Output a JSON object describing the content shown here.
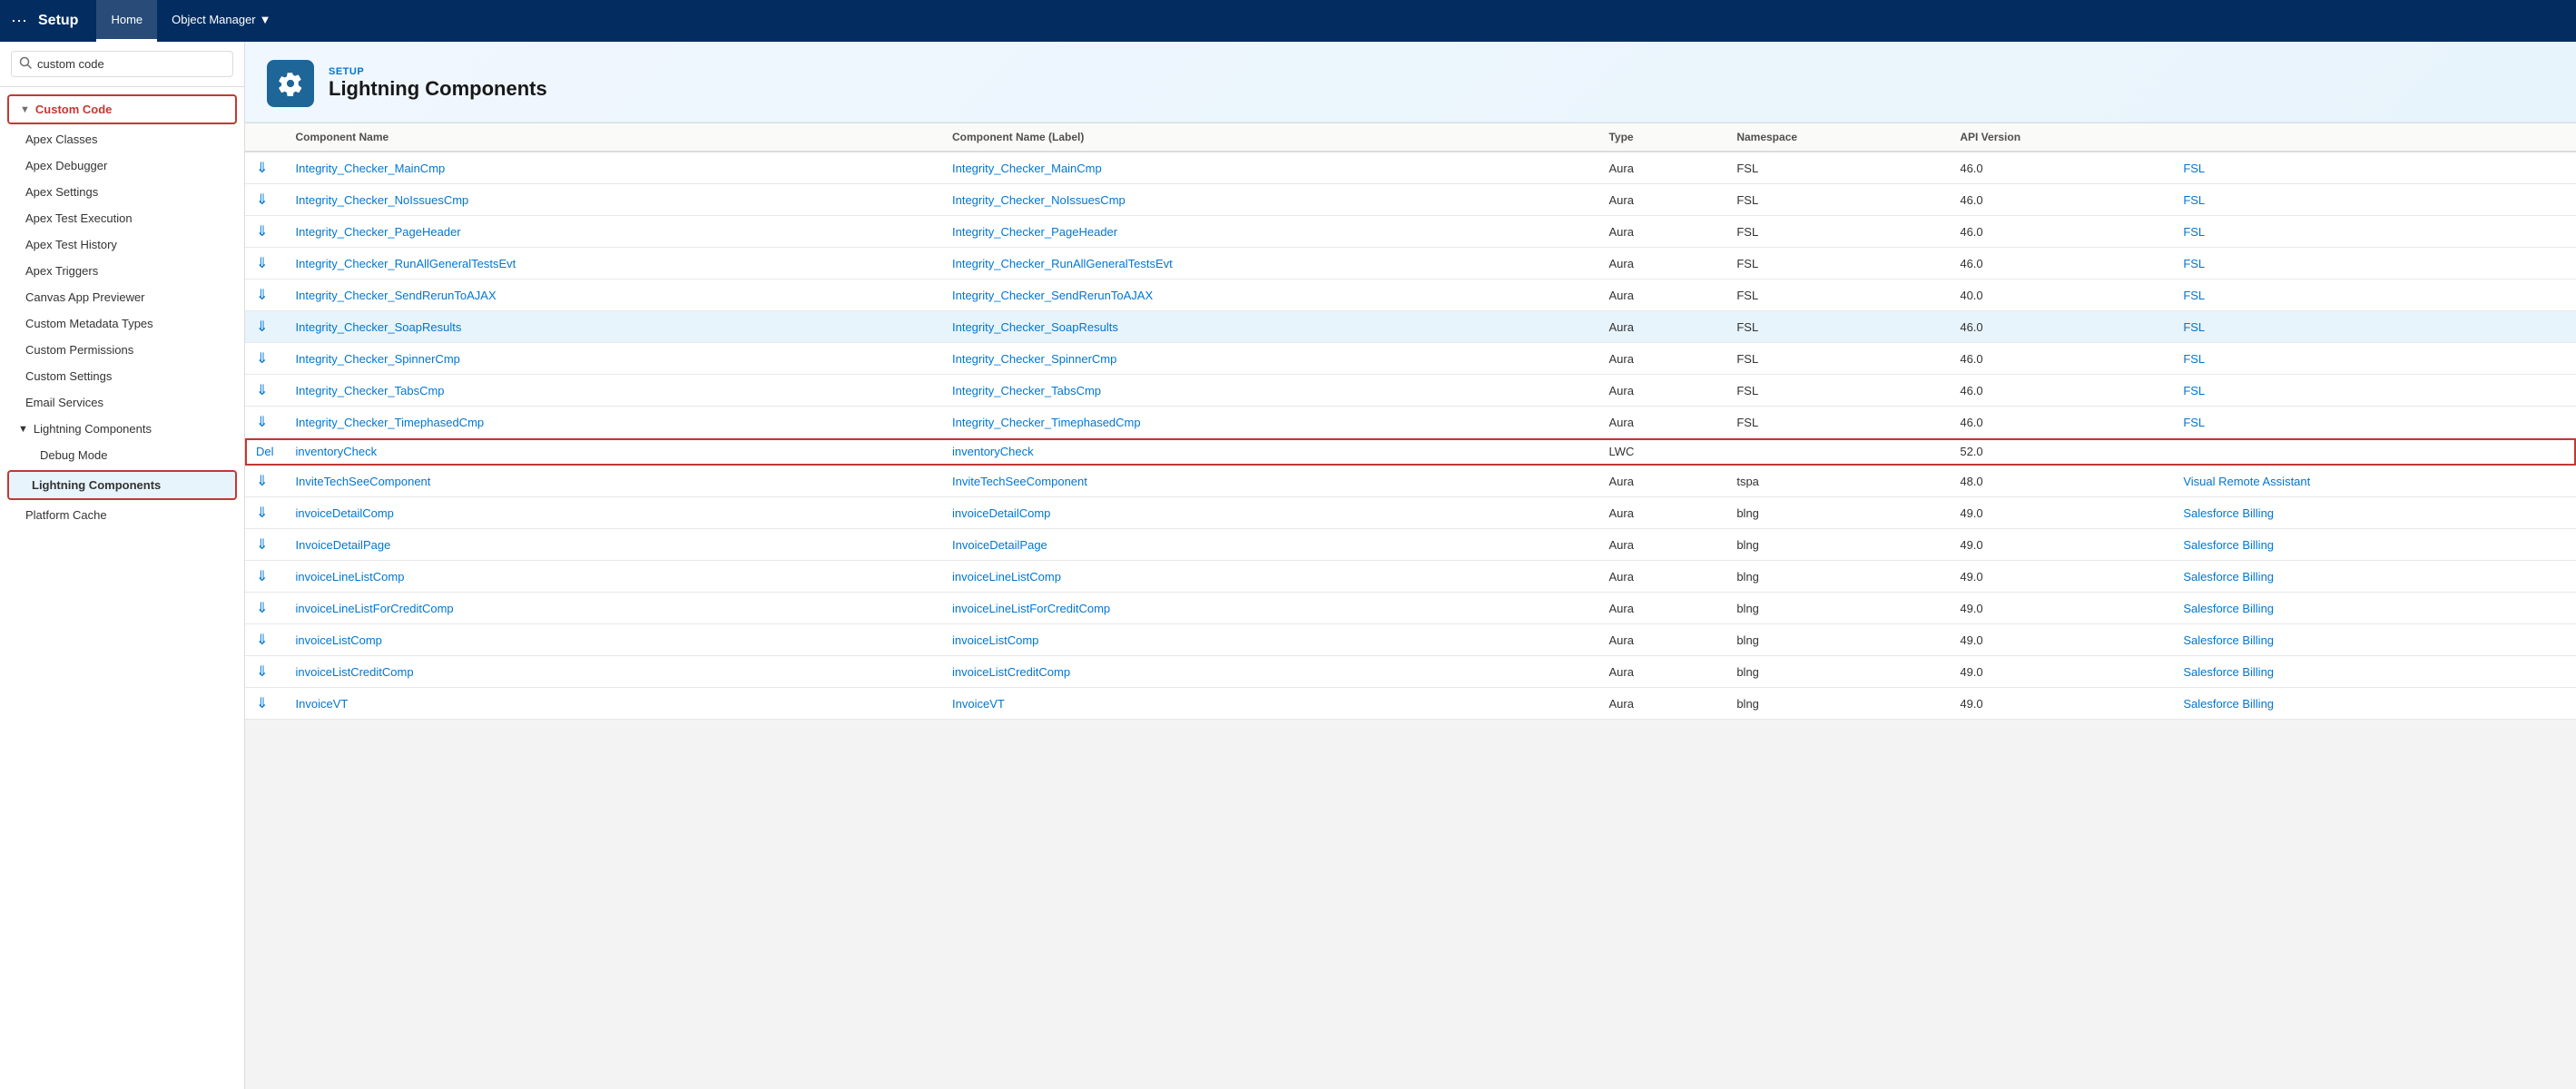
{
  "topNav": {
    "appLauncher": "⋯",
    "title": "Setup",
    "tabs": [
      {
        "label": "Home",
        "active": true
      },
      {
        "label": "Object Manager",
        "active": false,
        "hasArrow": true
      }
    ]
  },
  "search": {
    "placeholder": "custom code",
    "value": "custom code"
  },
  "sidebar": {
    "parentLabel": "Custom Code",
    "items": [
      {
        "label": "Apex Classes",
        "level": "child"
      },
      {
        "label": "Apex Debugger",
        "level": "child"
      },
      {
        "label": "Apex Settings",
        "level": "child"
      },
      {
        "label": "Apex Test Execution",
        "level": "child"
      },
      {
        "label": "Apex Test History",
        "level": "child"
      },
      {
        "label": "Apex Triggers",
        "level": "child"
      },
      {
        "label": "Canvas App Previewer",
        "level": "child"
      },
      {
        "label": "Custom Metadata Types",
        "level": "child"
      },
      {
        "label": "Custom Permissions",
        "level": "child"
      },
      {
        "label": "Custom Settings",
        "level": "child"
      },
      {
        "label": "Email Services",
        "level": "child"
      },
      {
        "label": "Lightning Components",
        "level": "sub-parent",
        "expanded": true
      },
      {
        "label": "Debug Mode",
        "level": "sub-child"
      },
      {
        "label": "Lightning Components",
        "level": "sub-child-active"
      },
      {
        "label": "Platform Cache",
        "level": "child"
      }
    ]
  },
  "pageHeader": {
    "setupLabel": "SETUP",
    "title": "Lightning Components"
  },
  "table": {
    "columns": [
      {
        "label": ""
      },
      {
        "label": "Component Name"
      },
      {
        "label": "Component Name (Label)"
      },
      {
        "label": "Type"
      },
      {
        "label": "Namespace"
      },
      {
        "label": "API Version"
      },
      {
        "label": ""
      }
    ],
    "rows": [
      {
        "hasDownload": true,
        "name": "Integrity_Checker_MainCmp",
        "nameLabel": "Integrity_Checker_MainCmp",
        "type": "Aura",
        "namespace": "FSL",
        "apiVersion": "46.0",
        "nsLink": "FSL",
        "del": "",
        "highlighted": false,
        "selected": false
      },
      {
        "hasDownload": true,
        "name": "Integrity_Checker_NoIssuesCmp",
        "nameLabel": "Integrity_Checker_NoIssuesCmp",
        "type": "Aura",
        "namespace": "FSL",
        "apiVersion": "46.0",
        "nsLink": "FSL",
        "del": "",
        "highlighted": false,
        "selected": false
      },
      {
        "hasDownload": true,
        "name": "Integrity_Checker_PageHeader",
        "nameLabel": "Integrity_Checker_PageHeader",
        "type": "Aura",
        "namespace": "FSL",
        "apiVersion": "46.0",
        "nsLink": "FSL",
        "del": "",
        "highlighted": false,
        "selected": false
      },
      {
        "hasDownload": true,
        "name": "Integrity_Checker_RunAllGeneralTestsEvt",
        "nameLabel": "Integrity_Checker_RunAllGeneralTestsEvt",
        "type": "Aura",
        "namespace": "FSL",
        "apiVersion": "46.0",
        "nsLink": "FSL",
        "del": "",
        "highlighted": false,
        "selected": false
      },
      {
        "hasDownload": true,
        "name": "Integrity_Checker_SendRerunToAJAX",
        "nameLabel": "Integrity_Checker_SendRerunToAJAX",
        "type": "Aura",
        "namespace": "FSL",
        "apiVersion": "40.0",
        "nsLink": "FSL",
        "del": "",
        "highlighted": false,
        "selected": false
      },
      {
        "hasDownload": true,
        "name": "Integrity_Checker_SoapResults",
        "nameLabel": "Integrity_Checker_SoapResults",
        "type": "Aura",
        "namespace": "FSL",
        "apiVersion": "46.0",
        "nsLink": "FSL",
        "del": "",
        "highlighted": true,
        "selected": false
      },
      {
        "hasDownload": true,
        "name": "Integrity_Checker_SpinnerCmp",
        "nameLabel": "Integrity_Checker_SpinnerCmp",
        "type": "Aura",
        "namespace": "FSL",
        "apiVersion": "46.0",
        "nsLink": "FSL",
        "del": "",
        "highlighted": false,
        "selected": false
      },
      {
        "hasDownload": true,
        "name": "Integrity_Checker_TabsCmp",
        "nameLabel": "Integrity_Checker_TabsCmp",
        "type": "Aura",
        "namespace": "FSL",
        "apiVersion": "46.0",
        "nsLink": "FSL",
        "del": "",
        "highlighted": false,
        "selected": false
      },
      {
        "hasDownload": true,
        "name": "Integrity_Checker_TimephasedCmp",
        "nameLabel": "Integrity_Checker_TimephasedCmp",
        "type": "Aura",
        "namespace": "FSL",
        "apiVersion": "46.0",
        "nsLink": "FSL",
        "del": "",
        "highlighted": false,
        "selected": false
      },
      {
        "hasDownload": false,
        "name": "inventoryCheck",
        "nameLabel": "inventoryCheck",
        "type": "LWC",
        "namespace": "",
        "apiVersion": "52.0",
        "nsLink": "",
        "del": "Del",
        "highlighted": false,
        "selected": true
      },
      {
        "hasDownload": true,
        "name": "InviteTechSeeComponent",
        "nameLabel": "InviteTechSeeComponent",
        "type": "Aura",
        "namespace": "tspa",
        "apiVersion": "48.0",
        "nsLink": "Visual Remote Assistant",
        "del": "",
        "highlighted": false,
        "selected": false
      },
      {
        "hasDownload": true,
        "name": "invoiceDetailComp",
        "nameLabel": "invoiceDetailComp",
        "type": "Aura",
        "namespace": "blng",
        "apiVersion": "49.0",
        "nsLink": "Salesforce Billing",
        "del": "",
        "highlighted": false,
        "selected": false
      },
      {
        "hasDownload": true,
        "name": "InvoiceDetailPage",
        "nameLabel": "InvoiceDetailPage",
        "type": "Aura",
        "namespace": "blng",
        "apiVersion": "49.0",
        "nsLink": "Salesforce Billing",
        "del": "",
        "highlighted": false,
        "selected": false
      },
      {
        "hasDownload": true,
        "name": "invoiceLineListComp",
        "nameLabel": "invoiceLineListComp",
        "type": "Aura",
        "namespace": "blng",
        "apiVersion": "49.0",
        "nsLink": "Salesforce Billing",
        "del": "",
        "highlighted": false,
        "selected": false
      },
      {
        "hasDownload": true,
        "name": "invoiceLineListForCreditComp",
        "nameLabel": "invoiceLineListForCreditComp",
        "type": "Aura",
        "namespace": "blng",
        "apiVersion": "49.0",
        "nsLink": "Salesforce Billing",
        "del": "",
        "highlighted": false,
        "selected": false
      },
      {
        "hasDownload": true,
        "name": "invoiceListComp",
        "nameLabel": "invoiceListComp",
        "type": "Aura",
        "namespace": "blng",
        "apiVersion": "49.0",
        "nsLink": "Salesforce Billing",
        "del": "",
        "highlighted": false,
        "selected": false
      },
      {
        "hasDownload": true,
        "name": "invoiceListCreditComp",
        "nameLabel": "invoiceListCreditComp",
        "type": "Aura",
        "namespace": "blng",
        "apiVersion": "49.0",
        "nsLink": "Salesforce Billing",
        "del": "",
        "highlighted": false,
        "selected": false
      },
      {
        "hasDownload": true,
        "name": "InvoiceVT",
        "nameLabel": "InvoiceVT",
        "type": "Aura",
        "namespace": "blng",
        "apiVersion": "49.0",
        "nsLink": "Salesforce Billing",
        "del": "",
        "highlighted": false,
        "selected": false
      }
    ]
  }
}
